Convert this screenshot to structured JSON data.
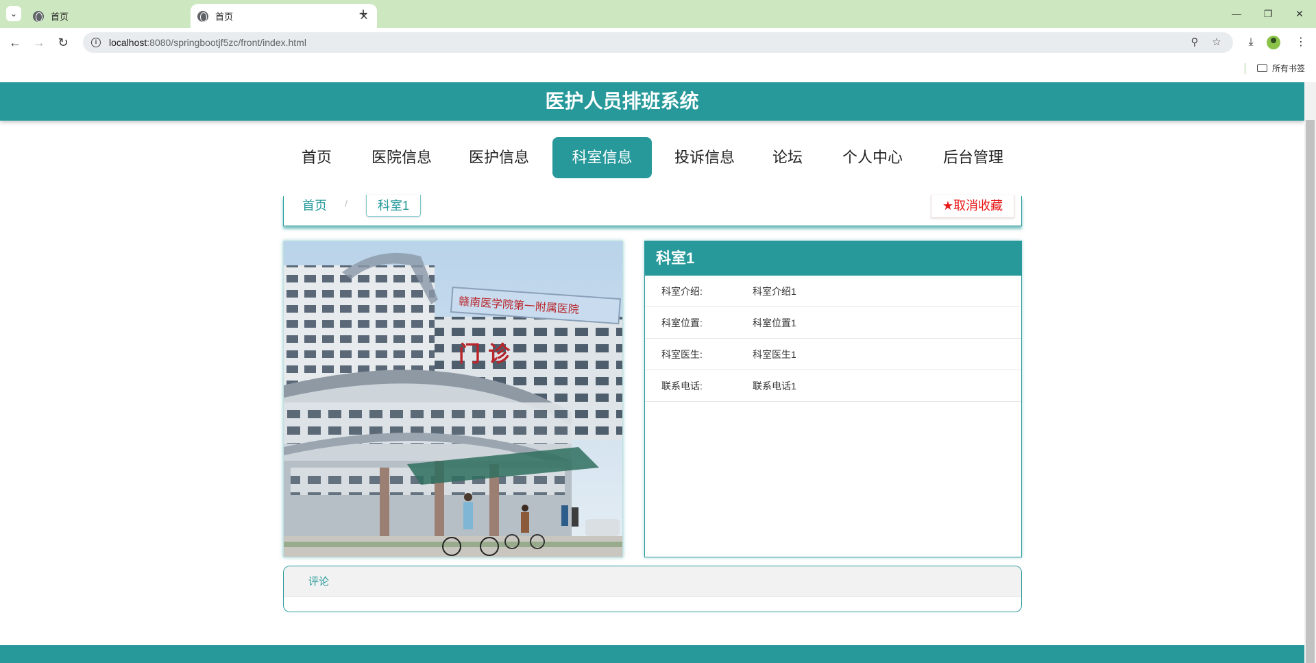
{
  "browser": {
    "tabs": [
      {
        "title": "首页",
        "active": false
      },
      {
        "title": "首页",
        "active": true
      }
    ],
    "url_host": "localhost",
    "url_path": ":8080/springbootjf5zc/front/index.html",
    "bookmarks_label": "所有书签"
  },
  "site": {
    "title": "医护人员排班系统",
    "nav": [
      "首页",
      "医院信息",
      "医护信息",
      "科室信息",
      "投诉信息",
      "论坛",
      "个人中心",
      "后台管理"
    ],
    "active_nav": "科室信息"
  },
  "breadcrumb": {
    "home": "首页",
    "separator": "/",
    "current": "科室1"
  },
  "favorite_button": "★取消收藏",
  "department": {
    "name": "科室1",
    "fields": [
      {
        "label": "科室介绍:",
        "value": "科室介绍1"
      },
      {
        "label": "科室位置:",
        "value": "科室位置1"
      },
      {
        "label": "科室医生:",
        "value": "科室医生1"
      },
      {
        "label": "联系电话:",
        "value": "联系电话1"
      }
    ],
    "image_sign_text": "赣南医学院第一附属医院",
    "image_door_text": "门 诊"
  },
  "comments": {
    "title": "评论"
  },
  "colors": {
    "primary": "#27999b",
    "favorite": "#e81818",
    "tabbar": "#cde8c0"
  }
}
